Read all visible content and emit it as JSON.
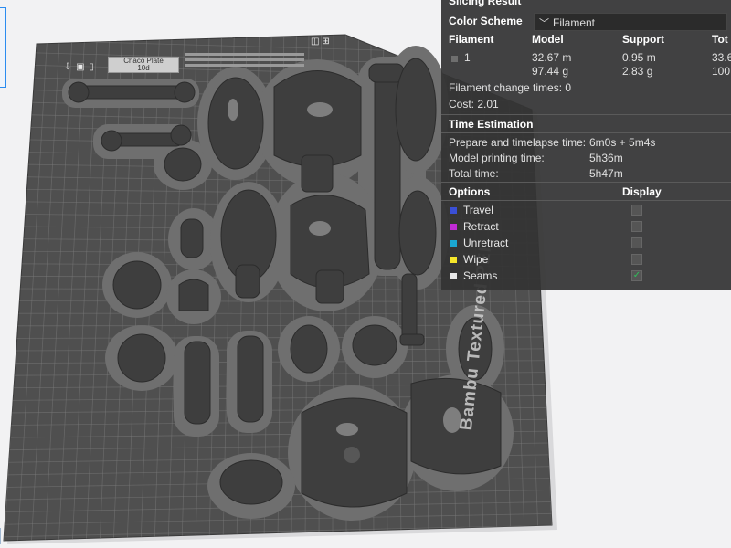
{
  "plate": {
    "label_line1": "Chaco Plate",
    "label_line2": "10d",
    "brand_text": "Bambu Textured PEI"
  },
  "panel": {
    "title": "Slicing Result",
    "color_scheme_label": "Color Scheme",
    "color_scheme_value": "Filament",
    "columns": [
      "Filament",
      "Model",
      "Support",
      "Tot"
    ],
    "filament_row": {
      "id": "1",
      "swatch_color": "#6e6e6e",
      "model_length": "32.67 m",
      "model_weight": "97.44 g",
      "support_length": "0.95 m",
      "support_weight": "2.83 g",
      "total_length": "33.6",
      "total_weight": "100"
    },
    "filament_change_text": "Filament change times:  0",
    "cost_text": "Cost:  2.01",
    "time_estimation": {
      "title": "Time Estimation",
      "rows": [
        {
          "label": "Prepare and timelapse time:",
          "value": "6m0s + 5m4s"
        },
        {
          "label": "Model printing time:",
          "value": "5h36m"
        },
        {
          "label": "Total time:",
          "value": "5h47m"
        }
      ]
    },
    "options": {
      "title": "Options",
      "display_title": "Display",
      "items": [
        {
          "label": "Travel",
          "color": "#3a4fd6",
          "checked": false
        },
        {
          "label": "Retract",
          "color": "#c02bd6",
          "checked": false
        },
        {
          "label": "Unretract",
          "color": "#1aa6d0",
          "checked": false
        },
        {
          "label": "Wipe",
          "color": "#f5e62a",
          "checked": false
        },
        {
          "label": "Seams",
          "color": "#e8e8e8",
          "checked": true
        }
      ]
    }
  }
}
